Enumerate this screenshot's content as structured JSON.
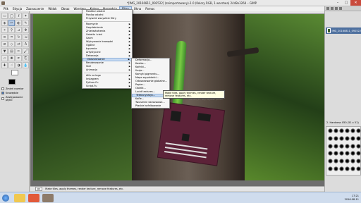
{
  "window": {
    "title": "*[IMG_20160811_092522] (zaimportowany)-1.0 (Kolory RGB, 1 warstwa) 2448x3264 – GIMP",
    "minimize": "–",
    "maximize": "□",
    "close": "✕"
  },
  "menubar": {
    "items": [
      "Plik",
      "Edycja",
      "Zaznaczenie",
      "Widok",
      "Obraz",
      "Warstwa",
      "Kolory",
      "Narzędzia",
      "Filtry",
      "Okna",
      "Pomoc"
    ],
    "active_index": 8
  },
  "filters_menu": {
    "items": [
      {
        "label": "Powtórz ostatni",
        "submenu": false
      },
      {
        "label": "Ponów ostatni",
        "submenu": false
      },
      {
        "label": "Przywróć wszystkie filtry",
        "submenu": false
      },
      {
        "label": "Rozmycie",
        "submenu": true
      },
      {
        "label": "Uwydatnienie",
        "submenu": true
      },
      {
        "label": "Zniekształcenia",
        "submenu": true
      },
      {
        "label": "Światło i cień",
        "submenu": true
      },
      {
        "label": "Szum",
        "submenu": true
      },
      {
        "label": "Wykrywanie krawędzi",
        "submenu": true
      },
      {
        "label": "Ogólne",
        "submenu": true
      },
      {
        "label": "Łączenie",
        "submenu": true
      },
      {
        "label": "Artystyczne",
        "submenu": true
      },
      {
        "label": "Dekoracja",
        "submenu": true
      },
      {
        "label": "Odwzorowanie",
        "submenu": true
      },
      {
        "label": "Renderowanie",
        "submenu": true
      },
      {
        "label": "Sieć",
        "submenu": true
      },
      {
        "label": "Animacja",
        "submenu": true
      },
      {
        "label": "Alfa na logo",
        "submenu": true
      },
      {
        "label": "Instagram",
        "submenu": true
      },
      {
        "label": "Python-Fu",
        "submenu": true
      },
      {
        "label": "Script-Fu",
        "submenu": true
      }
    ],
    "highlight_index": 13
  },
  "submenu": {
    "items": [
      "Deformacja...",
      "Kostka...",
      "Kafelki...",
      "Iluzja...",
      "Kamyki pigmentu...",
      "Mapa wypukłości...",
      "Odwzorowanie globalne...",
      "Papier...",
      "Obiekt...",
      "Lucid textures...",
      "Teksturyzacja...",
      "Kafle...",
      "Tworzenie bezszwowe...",
      "Płaskie kafelkowanie"
    ],
    "highlight_index": 10
  },
  "tooltip": {
    "text": "Make tiles, apply themes, render texture, remove features, etc.",
    "hint": "Naciśnij F1, aby uzyskać pomoc"
  },
  "tool_options": {
    "opt1": "Zmień rozmiar",
    "opt2": "Krawędzie",
    "opt3": "Zastępowanie płytki"
  },
  "statusbar": {
    "coords": "",
    "unit": "px",
    "message": "Make tiles, apply themes, render texture, remove features, etc."
  },
  "dock": {
    "tab": "Warstwy",
    "layer_name": "IMG_20160811_092522",
    "brush_label": "2. Hardness 050 (51 x 51)"
  },
  "taskbar": {
    "time": "17:21",
    "date": "2016-08-11"
  }
}
